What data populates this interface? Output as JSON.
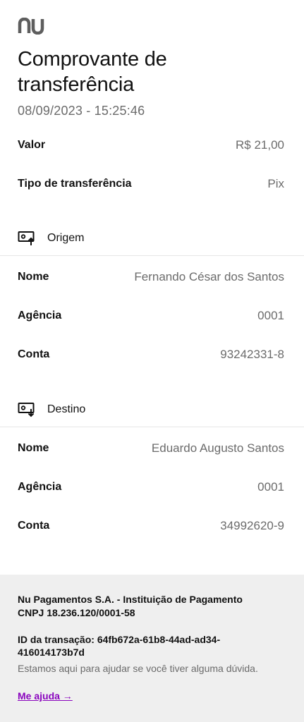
{
  "brand": {
    "logo_icon": "nu-logo-icon"
  },
  "header": {
    "title": "Comprovante de transferência",
    "datetime": "08/09/2023 - 15:25:46"
  },
  "summary": [
    {
      "label": "Valor",
      "value": "R$ 21,00"
    },
    {
      "label": "Tipo de transferência",
      "value": "Pix"
    }
  ],
  "origin": {
    "section_label": "Origem",
    "icon": "payment-out-icon",
    "rows": [
      {
        "label": "Nome",
        "value": "Fernando César dos Santos"
      },
      {
        "label": "Agência",
        "value": "0001"
      },
      {
        "label": "Conta",
        "value": "93242331-8"
      }
    ]
  },
  "destination": {
    "section_label": "Destino",
    "icon": "payment-in-icon",
    "rows": [
      {
        "label": "Nome",
        "value": "Eduardo Augusto Santos"
      },
      {
        "label": "Agência",
        "value": "0001"
      },
      {
        "label": "Conta",
        "value": "34992620-9"
      }
    ]
  },
  "footer": {
    "company": "Nu Pagamentos S.A. - Instituição de Pagamento",
    "cnpj": "CNPJ 18.236.120/0001-58",
    "transaction_id": "ID da transação: 64fb672a-61b8-44ad-ad34-416014173b7d",
    "help_text": "Estamos aqui para ajudar se você tiver alguma dúvida.",
    "help_link": "Me ajuda →"
  },
  "colors": {
    "link": "#8a05be",
    "muted": "#6b6b6b",
    "footer_bg": "#efefef"
  }
}
